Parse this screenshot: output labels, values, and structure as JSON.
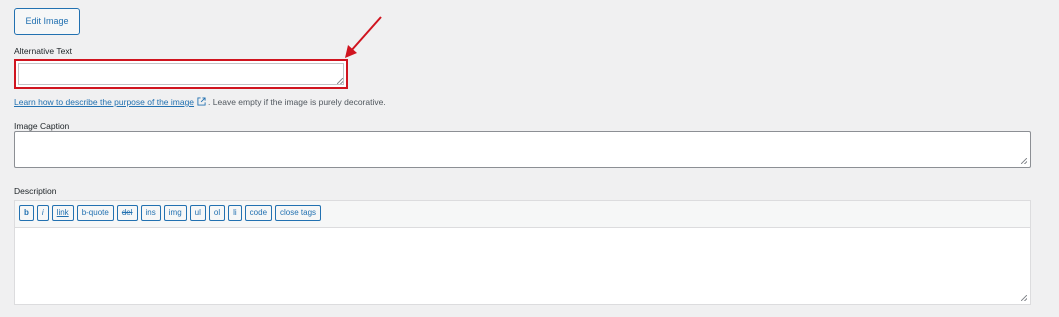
{
  "edit_image": {
    "label": "Edit Image"
  },
  "alt_text": {
    "label": "Alternative Text",
    "value": "",
    "help_link": "Learn how to describe the purpose of the image",
    "help_suffix": ". Leave empty if the image is purely decorative."
  },
  "caption": {
    "label": "Image Caption",
    "value": ""
  },
  "description": {
    "label": "Description",
    "value": "",
    "toolbar": [
      "b",
      "i",
      "link",
      "b-quote",
      "del",
      "ins",
      "img",
      "ul",
      "ol",
      "li",
      "code",
      "close tags"
    ]
  },
  "colors": {
    "highlight": "#d0141f",
    "accent": "#2271b1"
  },
  "icons": {
    "help_link": "external-link-icon",
    "annotation": "red-arrow-annotation"
  }
}
